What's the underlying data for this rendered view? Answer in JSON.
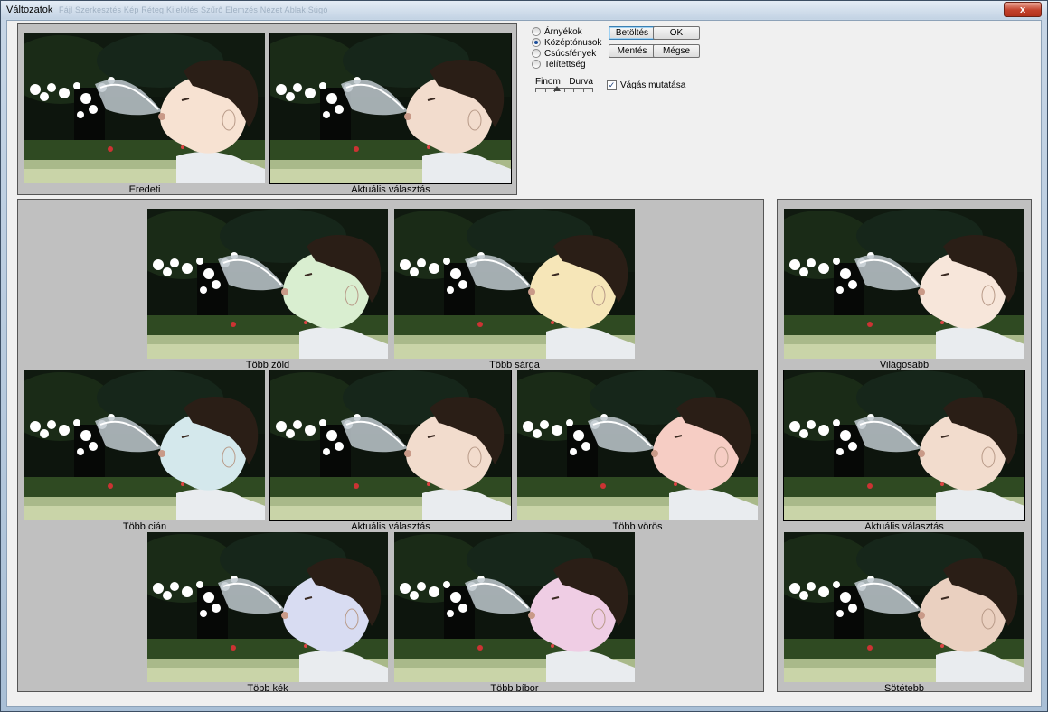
{
  "window": {
    "title": "Változatok",
    "menu_ghost": [
      "Fájl",
      "Szerkesztés",
      "Kép",
      "Réteg",
      "Kijelölés",
      "Szűrő",
      "Elemzés",
      "Nézet",
      "Ablak",
      "Súgó"
    ],
    "close_label": "x"
  },
  "top": {
    "original_caption": "Eredeti",
    "current_caption": "Aktuális választás"
  },
  "tones": [
    {
      "label": "Árnyékok",
      "selected": false
    },
    {
      "label": "Középtónusok",
      "selected": true
    },
    {
      "label": "Csúcsfények",
      "selected": false
    },
    {
      "label": "Telítettség",
      "selected": false
    }
  ],
  "buttons": {
    "load": "Betöltés",
    "ok": "OK",
    "save": "Mentés",
    "cancel": "Mégse"
  },
  "slider": {
    "fine_label": "Finom",
    "coarse_label": "Durva",
    "ticks": 7,
    "value_index": 3
  },
  "clipping": {
    "label": "Vágás mutatása",
    "checked": true,
    "check_glyph": "✓"
  },
  "color_grid": {
    "more_green": "Több zöld",
    "more_yellow": "Több sárga",
    "more_cyan": "Több cián",
    "current": "Aktuális választás",
    "more_red": "Több vörös",
    "more_blue": "Több kék",
    "more_magenta": "Több bíbor"
  },
  "lightness": {
    "lighter": "Világosabb",
    "current": "Aktuális választás",
    "darker": "Sötétebb"
  },
  "tints": {
    "original": "#f7e2d2",
    "current": "#f2dccd",
    "green": "#d9eed0",
    "yellow": "#f6e6b8",
    "cyan": "#d4e8ec",
    "red": "#f6cdc4",
    "blue": "#d8dcf2",
    "magenta": "#efcde4",
    "lighter": "#f7e6da",
    "darker": "#ead0c0"
  }
}
